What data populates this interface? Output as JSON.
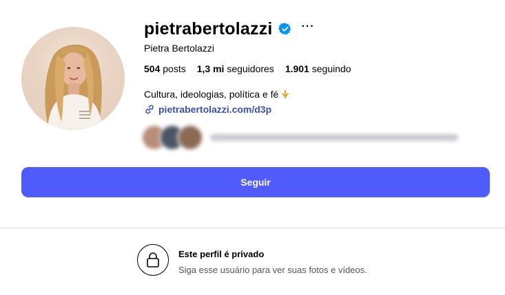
{
  "profile": {
    "username": "pietrabertolazzi",
    "full_name": "Pietra Bertolazzi",
    "verified": true,
    "more_label": "···",
    "stats": {
      "posts_count": "504",
      "posts_label": "posts",
      "followers_count": "1,3 mi",
      "followers_label": "seguidores",
      "following_count": "1.901",
      "following_label": "seguindo"
    },
    "bio": "Cultura, ideologias, política e fé",
    "bio_emoji": "fleur-de-lis",
    "link": "pietrabertolazzi.com/d3p"
  },
  "actions": {
    "follow_label": "Seguir"
  },
  "private_notice": {
    "title": "Este perfil é privado",
    "subtitle": "Siga esse usuário para ver suas fotos e vídeos."
  },
  "colors": {
    "follow_button": "#4f5bfa",
    "link": "#3a4fb4",
    "verified_badge": "#0095f6",
    "divider": "#dbdbdb"
  }
}
